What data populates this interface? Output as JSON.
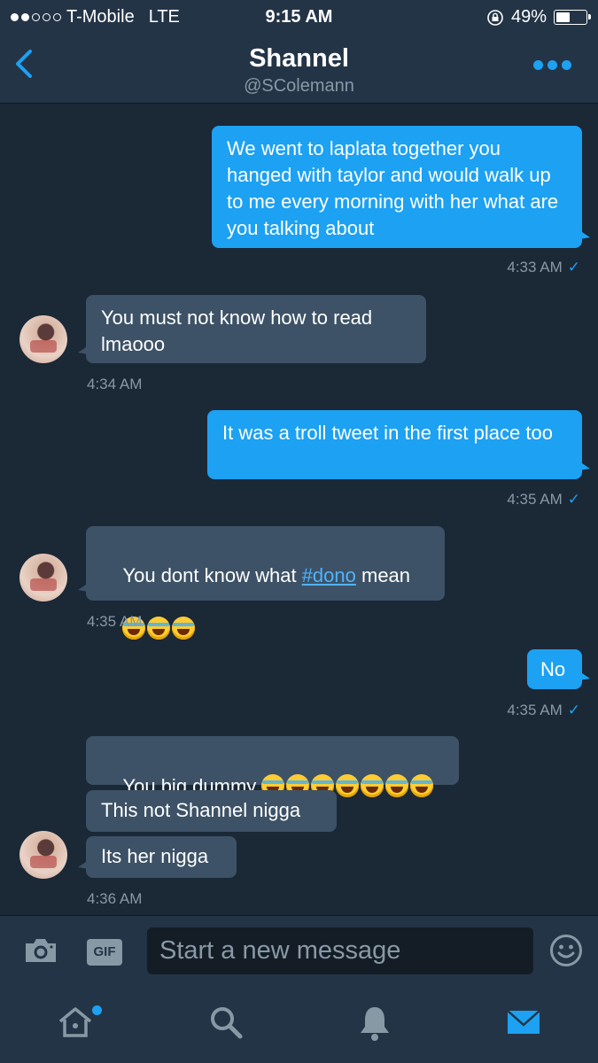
{
  "status_bar": {
    "carrier": "T-Mobile",
    "network": "LTE",
    "time": "9:15 AM",
    "battery": "49%",
    "battery_level": 0.49,
    "signal_bars": 2
  },
  "header": {
    "name": "Shannel",
    "handle": "@SColemann",
    "back_icon": "chevron-left-icon",
    "more_icon": "more-dots-icon"
  },
  "messages": [
    {
      "direction": "out",
      "text": "We went to laplata together you hanged with taylor and would walk up to me every morning with her what are you talking about",
      "time": "4:33 AM"
    },
    {
      "direction": "in",
      "text": "You must not know how to read lmaooo",
      "time": "4:34 AM"
    },
    {
      "direction": "out",
      "text": "It was a troll tweet in the first place too",
      "time": "4:35 AM"
    },
    {
      "direction": "in",
      "text_before": "You dont know what ",
      "hashtag": "#dono",
      "text_after": " mean",
      "emoji_count": 3,
      "time": "4:35 AM"
    },
    {
      "direction": "out",
      "text": "No",
      "time": "4:35 AM"
    },
    {
      "direction": "in",
      "text": "You big dummy ",
      "emoji_count": 7
    },
    {
      "direction": "in",
      "text": "This not Shannel nigga"
    },
    {
      "direction": "in",
      "text": "Its her nigga",
      "time": "4:36 AM"
    }
  ],
  "composer": {
    "placeholder": "Start a new message",
    "gif_label": "GIF",
    "camera_icon": "camera-icon",
    "emoji_icon": "smiley-icon"
  },
  "tab_bar": {
    "items": [
      "home-icon",
      "search-icon",
      "notifications-bell-icon",
      "messages-envelope-icon"
    ],
    "active": "messages-envelope-icon"
  },
  "colors": {
    "background": "#1b2836",
    "bar": "#243447",
    "accent": "#1da1f2",
    "incoming_bubble": "#3d5266",
    "muted": "#8899a6"
  }
}
